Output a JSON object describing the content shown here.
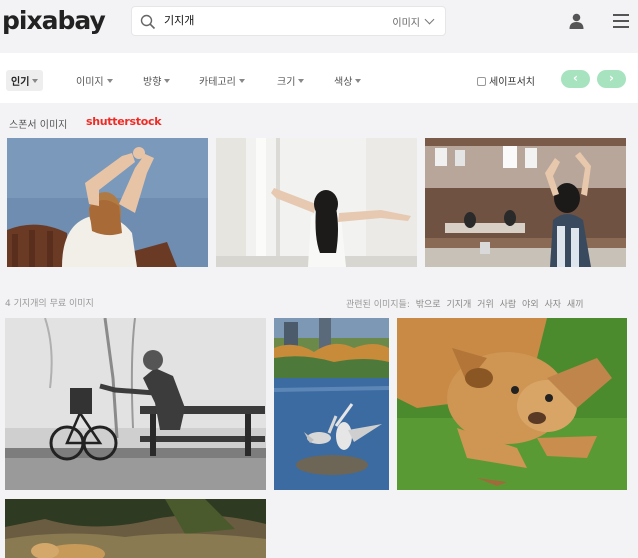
{
  "header": {
    "logo": "pixabay",
    "search_value": "기지개",
    "search_type": "이미지"
  },
  "filters": {
    "items": [
      "인기",
      "이미지",
      "방향",
      "카테고리",
      "크기",
      "색상"
    ],
    "safesearch_label": "세이프서치",
    "prev": "‹",
    "next": "›"
  },
  "sponsor": {
    "label": "스폰서 이미지",
    "brand": "shutterstock"
  },
  "results": {
    "count_label": "4 기지개의 무료 이미지",
    "related_label": "관련된 이미지들:",
    "related": [
      "밖으로",
      "기지개",
      "거위",
      "사람",
      "야외",
      "사자",
      "새끼"
    ]
  },
  "colors": {
    "safe_btn": "#a7e3bf",
    "brand_red": "#ee2b24"
  }
}
